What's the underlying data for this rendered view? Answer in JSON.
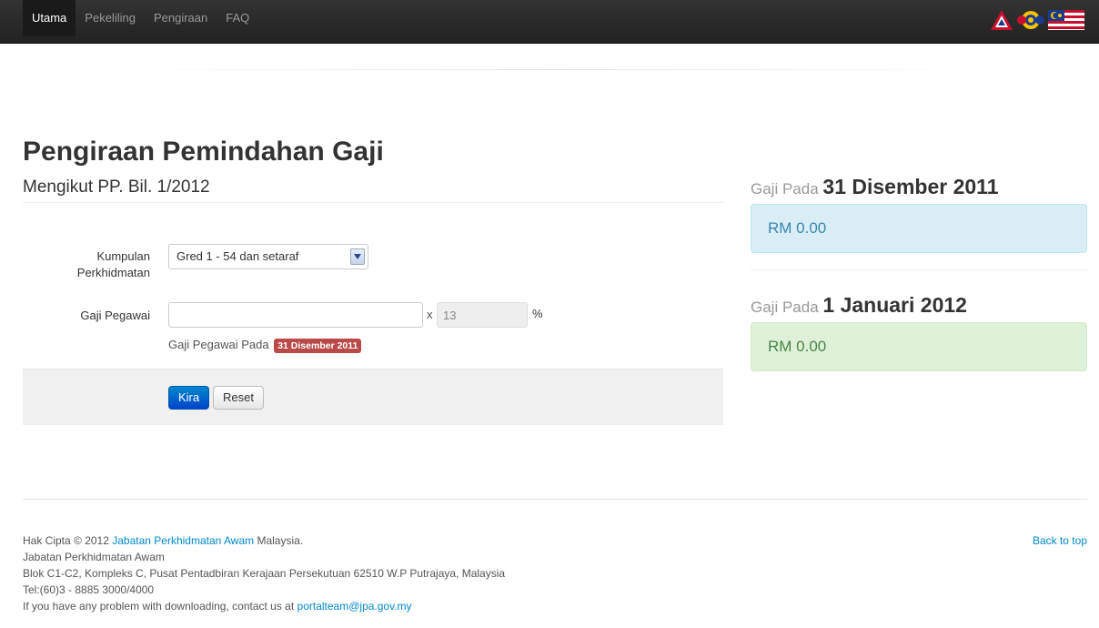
{
  "nav": {
    "items": [
      {
        "label": "Utama",
        "active": true
      },
      {
        "label": "Pekeliling",
        "active": false
      },
      {
        "label": "Pengiraan",
        "active": false
      },
      {
        "label": "FAQ",
        "active": false
      }
    ]
  },
  "page": {
    "title": "Pengiraan Pemindahan Gaji",
    "subtitle": "Mengikut PP. Bil. 1/2012"
  },
  "form": {
    "kumpulan_label": "Kumpulan Perkhidmatan",
    "kumpulan_value": "Gred 1 - 54 dan setaraf",
    "gaji_label": "Gaji Pegawai",
    "gaji_value": "",
    "times": "x",
    "percent_value": "13",
    "percent_sign": "%",
    "help_text": "Gaji Pegawai Pada",
    "help_badge": "31 Disember 2011",
    "kira_label": "Kira",
    "reset_label": "Reset"
  },
  "results": {
    "prefix": "Gaji Pada",
    "date1": "31 Disember 2011",
    "amount1": "RM 0.00",
    "date2": "1 Januari 2012",
    "amount2": "RM 0.00"
  },
  "footer": {
    "copyright_pre": "Hak Cipta © 2012",
    "copyright_link": "Jabatan Perkhidmatan Awam",
    "copyright_post": "Malaysia.",
    "line2": "Jabatan Perkhidmatan Awam",
    "line3": "Blok C1-C2, Kompleks C, Pusat Pentadbiran Kerajaan Persekutuan 62510 W.P Putrajaya, Malaysia",
    "line4": "Tel:(60)3 - 8885 3000/4000",
    "line5_pre": "If you have any problem with downloading, contact us at",
    "email": "portalteam@jpa.gov.my",
    "back_to_top": "Back to top"
  },
  "colors": {
    "navbar": "#222222",
    "primary": "#0088cc",
    "danger_badge": "#b94a48",
    "info_bg": "#d9edf7",
    "success_bg": "#dff0d8"
  },
  "icons": {
    "logo": "jpa-1malaysia-flag-logo",
    "select_arrow": "chevron-down-icon"
  }
}
